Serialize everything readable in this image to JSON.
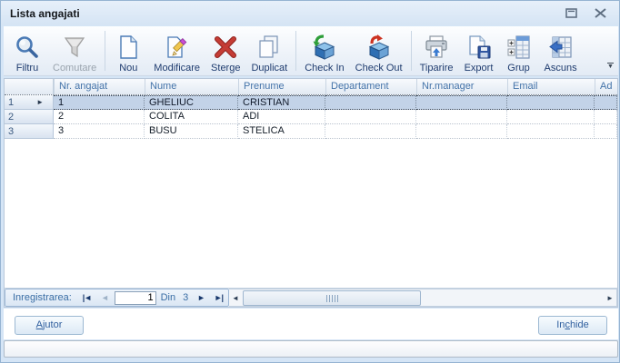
{
  "window": {
    "title": "Lista angajati"
  },
  "toolbar": {
    "buttons": [
      {
        "label": "Filtru",
        "icon": "search-filter-icon",
        "enabled": true
      },
      {
        "label": "Comutare",
        "icon": "funnel-icon",
        "enabled": false
      },
      {
        "label": "Nou",
        "icon": "new-document-icon",
        "enabled": true
      },
      {
        "label": "Modificare",
        "icon": "edit-document-icon",
        "enabled": true
      },
      {
        "label": "Sterge",
        "icon": "delete-x-icon",
        "enabled": true
      },
      {
        "label": "Duplicat",
        "icon": "duplicate-pages-icon",
        "enabled": true
      },
      {
        "label": "Check In",
        "icon": "check-in-box-icon",
        "enabled": true
      },
      {
        "label": "Check Out",
        "icon": "check-out-box-icon",
        "enabled": true
      },
      {
        "label": "Tiparire",
        "icon": "printer-icon",
        "enabled": true
      },
      {
        "label": "Export",
        "icon": "export-save-icon",
        "enabled": true
      },
      {
        "label": "Grup",
        "icon": "group-table-icon",
        "enabled": true
      },
      {
        "label": "Ascuns",
        "icon": "hidden-columns-icon",
        "enabled": true
      }
    ]
  },
  "grid": {
    "columns": [
      "Nr. angajat",
      "Nume",
      "Prenume",
      "Departament",
      "Nr.manager",
      "Email",
      "Ad"
    ],
    "rows": [
      {
        "num": "1",
        "selected": true,
        "cells": [
          "1",
          "GHELIUC",
          "CRISTIAN",
          "",
          "",
          "",
          ""
        ]
      },
      {
        "num": "2",
        "selected": false,
        "cells": [
          "2",
          "COLITA",
          "ADI",
          "",
          "",
          "",
          ""
        ]
      },
      {
        "num": "3",
        "selected": false,
        "cells": [
          "3",
          "BUSU",
          "STELICA",
          "",
          "",
          "",
          ""
        ]
      }
    ]
  },
  "nav": {
    "label": "Inregistrarea:",
    "value": "1",
    "of_label": "Din",
    "total": "3",
    "first_glyph": "|◄",
    "prev_glyph": "◄",
    "next_glyph": "►",
    "last_glyph": "►|",
    "scroll_left_glyph": "◄",
    "scroll_right_glyph": "►"
  },
  "footer": {
    "help": {
      "pre": "",
      "key": "A",
      "rest": "jutor"
    },
    "close": {
      "pre": "In",
      "key": "c",
      "rest": "hide"
    }
  },
  "colors": {
    "accent": "#2f5e9e",
    "selection": "#c3d3e8",
    "header_text": "#4473a9",
    "toolbar_label": "#1e3b6e",
    "disabled_label": "#9aa4ae",
    "frame": "#d5e5f6"
  }
}
